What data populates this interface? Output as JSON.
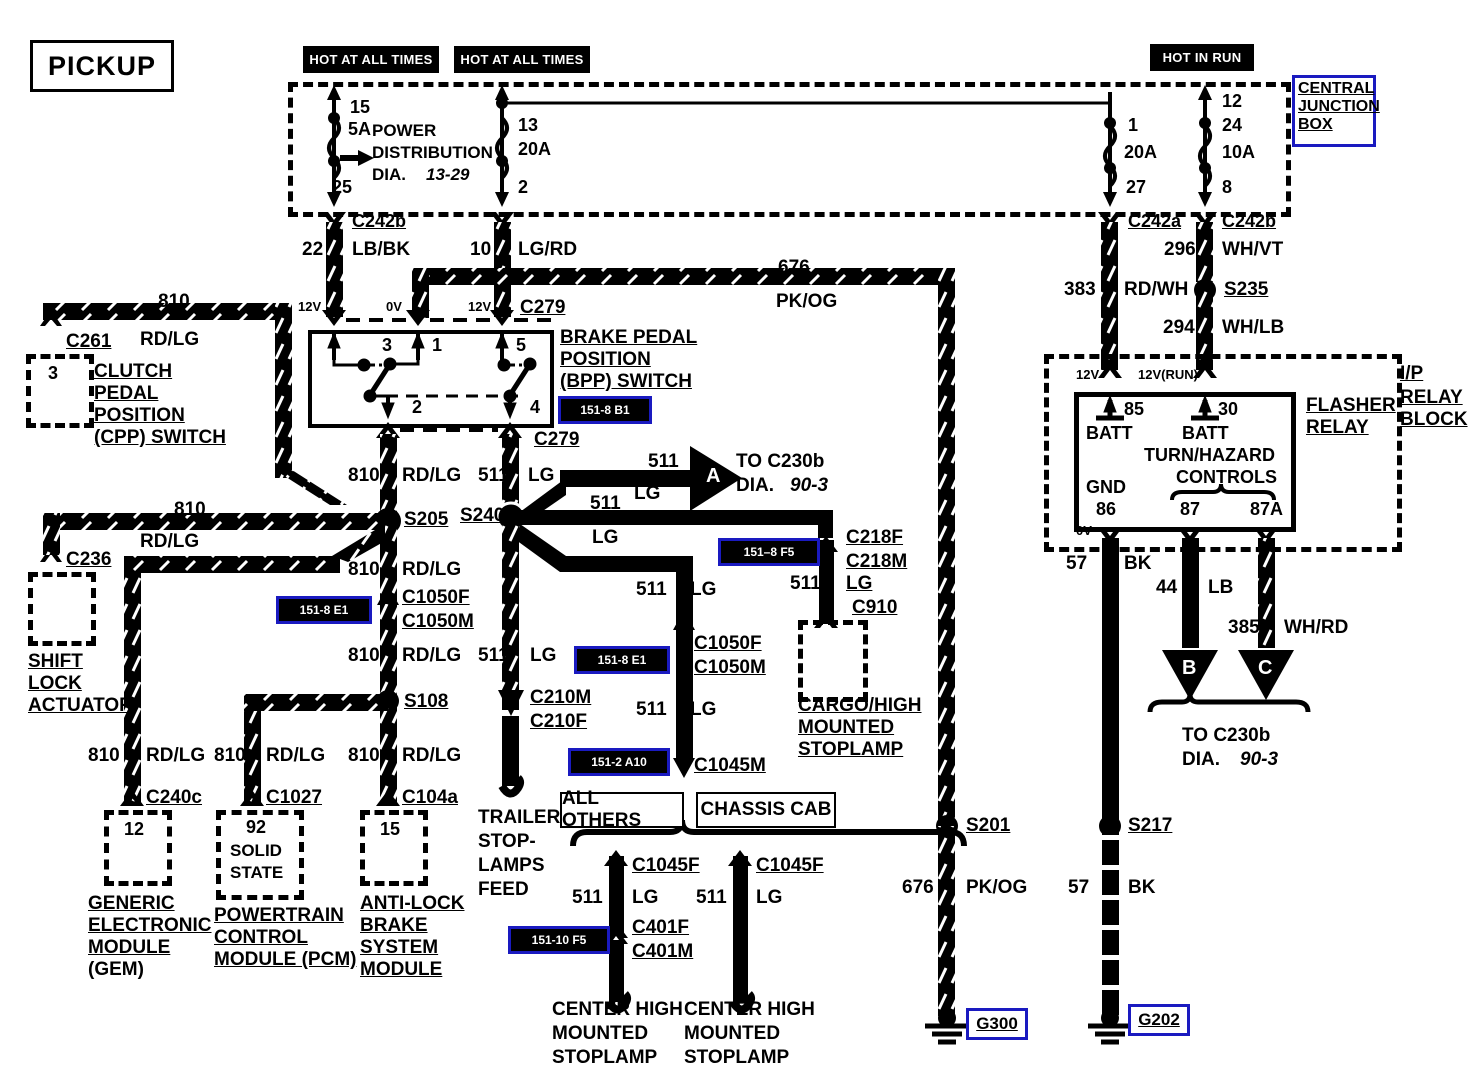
{
  "title": "PICKUP",
  "power_headers": [
    {
      "label": "HOT AT ALL TIMES"
    },
    {
      "label": "HOT AT ALL TIMES"
    },
    {
      "label": "HOT IN RUN"
    }
  ],
  "central_junction_box": {
    "label_lines": [
      "CENTRAL",
      "JUNCTION",
      "BOX"
    ],
    "block_title": [
      "POWER",
      "DISTRIBUTION",
      "DIA."
    ],
    "block_ref": "13-29",
    "fuses": [
      {
        "top_pin": "15",
        "rating": "5A",
        "bottom_pin": "25"
      },
      {
        "top_pin": "13",
        "rating": "20A",
        "bottom_pin": "2"
      },
      {
        "top_pin": "1",
        "rating": "20A",
        "bottom_pin": "27"
      },
      {
        "top_pin": "12",
        "rating": "24",
        "rating2": "10A",
        "bottom_pin": "8"
      }
    ],
    "connectors": [
      "C242b",
      "C242b",
      "C242a",
      "C242b"
    ]
  },
  "wires": {
    "w22": {
      "num": "22",
      "color": "LB/BK"
    },
    "w10": {
      "num": "10",
      "color": "LG/RD"
    },
    "w296": {
      "num": "296",
      "color": "WH/VT"
    },
    "w294": {
      "num": "294",
      "color": "WH/LB"
    },
    "w383": {
      "num": "383",
      "color": "RD/WH"
    },
    "w676": {
      "num": "676",
      "color": "PK/OG"
    },
    "w676b": {
      "num": "676",
      "color": "PK/OG"
    },
    "w810": {
      "num": "810",
      "color": "RD/LG"
    },
    "w511": {
      "num": "511",
      "color": "LG"
    },
    "w57": {
      "num": "57",
      "color": "BK"
    },
    "w44": {
      "num": "44",
      "color": "LB"
    },
    "w385": {
      "num": "385",
      "color": "WH/RD"
    },
    "w57b": {
      "num": "57",
      "color": "BK"
    }
  },
  "voltages": {
    "v12_lbbk": "12V",
    "v0_lgrd": "0V",
    "v12_c279": "12V",
    "v12_cjb": "12V",
    "v12run": "12V(RUN)",
    "v0_relay": "0V"
  },
  "bpp_switch": {
    "title_lines": [
      "BRAKE PEDAL",
      "POSITION",
      "(BPP) SWITCH"
    ],
    "pins_top": [
      "3",
      "1",
      "5"
    ],
    "pins_bottom": [
      "2",
      "4"
    ],
    "grid_ref": "151-8 B1",
    "connector_top": "C279",
    "connector_bottom": "C279"
  },
  "cpp_switch": {
    "title_lines": [
      "CLUTCH",
      "PEDAL",
      "POSITION",
      "(CPP) SWITCH"
    ],
    "pin": "3",
    "connector": "C261"
  },
  "shift_lock": {
    "title_lines": [
      "SHIFT",
      "LOCK",
      "ACTUATOR"
    ],
    "connector": "C236"
  },
  "flasher_relay": {
    "title_lines": [
      "FLASHER",
      "RELAY"
    ],
    "block_title_lines": [
      "I/P",
      "RELAY",
      "BLOCK"
    ],
    "pin_85": "85",
    "pin_30": "30",
    "pin_86": "86",
    "pin_87": "87",
    "pin_87a": "87A",
    "batt_left": "BATT",
    "batt_right": "BATT",
    "turn_hazard": "TURN/HAZARD",
    "controls": "CONTROLS",
    "gnd": "GND"
  },
  "splices": {
    "s205": "S205",
    "s240": "S240",
    "s108": "S108",
    "s235": "S235",
    "s201": "S201",
    "s217": "S217"
  },
  "grounds": {
    "g300": "G300",
    "g202": "G202"
  },
  "modules": [
    {
      "name_lines": [
        "GENERIC",
        "ELECTRONIC",
        "MODULE",
        "(GEM)"
      ],
      "pin": "12",
      "connector": "C240c"
    },
    {
      "name_lines": [
        "POWERTRAIN",
        "CONTROL",
        "MODULE (PCM)"
      ],
      "pin": "92",
      "inner": [
        "SOLID",
        "STATE"
      ],
      "connector": "C1027"
    },
    {
      "name_lines": [
        "ANTI-LOCK",
        "BRAKE",
        "SYSTEM",
        "MODULE"
      ],
      "pin": "15",
      "connector": "C104a"
    }
  ],
  "cargo_lamp": {
    "name_lines": [
      "CARGO/HIGH",
      "MOUNTED",
      "STOPLAMP"
    ],
    "connectors": [
      "C218F",
      "C218M",
      "C910"
    ]
  },
  "trailer_feed": {
    "name_lines": [
      "TRAILER",
      "STOP-",
      "LAMPS",
      "FEED"
    ]
  },
  "variant_boxes": [
    {
      "label": "ALL OTHERS"
    },
    {
      "label": "CHASSIS CAB"
    }
  ],
  "chmsl": [
    {
      "name_lines": [
        "CENTER HIGH",
        "MOUNTED",
        "STOPLAMP"
      ],
      "connectors": [
        "C1045F",
        "C401F",
        "C401M"
      ],
      "wire_num": "511",
      "wire_color": "LG"
    },
    {
      "name_lines": [
        "CENTER HIGH",
        "MOUNTED",
        "STOPLAMP"
      ],
      "connectors": [
        "C1045F"
      ],
      "wire_num": "511",
      "wire_color": "LG"
    }
  ],
  "connectors": {
    "c279a": "C279",
    "c279b": "C279",
    "c1050f_1": "C1050F",
    "c1050m_1": "C1050M",
    "c1050f_2": "C1050F",
    "c1050m_2": "C1050M",
    "c210m": "C210M",
    "c210f": "C210F",
    "c1045m": "C1045M",
    "c218f": "C218F",
    "c218m": "C218M",
    "c910": "C910",
    "c1045f_1": "C1045F",
    "c1045f_2": "C1045F",
    "c401f": "C401F",
    "c401m": "C401M",
    "c240c": "C240c",
    "c1027": "C1027",
    "c104a": "C104a",
    "c261": "C261",
    "c236": "C236"
  },
  "grid_refs": [
    {
      "id": "ref_bpp",
      "label": "151-8 B1"
    },
    {
      "id": "ref_e1_left",
      "label": "151-8 E1"
    },
    {
      "id": "ref_f5",
      "label": "151–8 F5"
    },
    {
      "id": "ref_e1_mid",
      "label": "151-8 E1"
    },
    {
      "id": "ref_a10",
      "label": "151-2 A10"
    },
    {
      "id": "ref_f5_10",
      "label": "151-10 F5"
    }
  ],
  "off_page": [
    {
      "letter": "A",
      "lines": [
        "TO C230b",
        "DIA."
      ],
      "ref": "90-3"
    },
    {
      "letter": "B",
      "lines": [],
      "ref": ""
    },
    {
      "letter": "C",
      "lines": [],
      "ref": ""
    },
    {
      "letter": "BC",
      "lines": [
        "TO C230b",
        "DIA."
      ],
      "ref": "90-3"
    }
  ],
  "colors": {
    "accent_blue": "#1a1ac0",
    "ink": "#000000",
    "paper": "#ffffff"
  }
}
